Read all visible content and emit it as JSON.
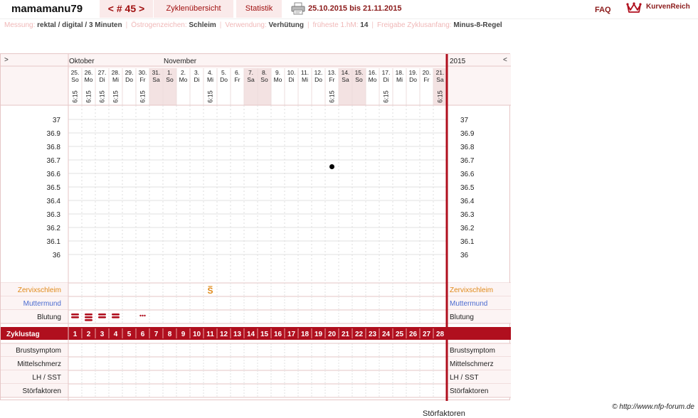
{
  "header": {
    "username": "mamamanu79",
    "cycle_prev": "<",
    "cycle_label": "# 45",
    "cycle_next": ">",
    "btn_overview": "Zyklenübersicht",
    "btn_stats": "Statistik",
    "date_range": "25.10.2015 bis 21.11.2015",
    "faq": "FAQ",
    "brand": "KurvenReich"
  },
  "settings": [
    {
      "key": "Messung:",
      "value": "rektal / digital / 3 Minuten"
    },
    {
      "key": "Östrogenzeichen:",
      "value": "Schleim"
    },
    {
      "key": "Verwendung:",
      "value": "Verhütung"
    },
    {
      "key": "früheste 1.hM:",
      "value": "14"
    },
    {
      "key": "Freigabe Zyklusanfang:",
      "value": "Minus-8-Regel"
    }
  ],
  "chart": {
    "nav_left": ">",
    "nav_right": "<",
    "months": [
      {
        "label": "Oktober",
        "day_index": 0
      },
      {
        "label": "November",
        "day_index": 7
      }
    ],
    "year": "2015",
    "days": [
      {
        "date": "25.",
        "wd": "So",
        "time": "6:15",
        "weekend": false
      },
      {
        "date": "26.",
        "wd": "Mo",
        "time": "6:15",
        "weekend": false
      },
      {
        "date": "27.",
        "wd": "Di",
        "time": "6:15",
        "weekend": false
      },
      {
        "date": "28.",
        "wd": "Mi",
        "time": "6:15",
        "weekend": false
      },
      {
        "date": "29.",
        "wd": "Do",
        "time": "",
        "weekend": false
      },
      {
        "date": "30.",
        "wd": "Fr",
        "time": "6:15",
        "weekend": false
      },
      {
        "date": "31.",
        "wd": "Sa",
        "time": "",
        "weekend": true
      },
      {
        "date": "1.",
        "wd": "So",
        "time": "",
        "weekend": true
      },
      {
        "date": "2.",
        "wd": "Mo",
        "time": "",
        "weekend": false
      },
      {
        "date": "3.",
        "wd": "Di",
        "time": "",
        "weekend": false
      },
      {
        "date": "4.",
        "wd": "Mi",
        "time": "6:15",
        "weekend": false
      },
      {
        "date": "5.",
        "wd": "Do",
        "time": "",
        "weekend": false
      },
      {
        "date": "6.",
        "wd": "Fr",
        "time": "",
        "weekend": false
      },
      {
        "date": "7.",
        "wd": "Sa",
        "time": "",
        "weekend": true
      },
      {
        "date": "8.",
        "wd": "So",
        "time": "",
        "weekend": true
      },
      {
        "date": "9.",
        "wd": "Mo",
        "time": "",
        "weekend": false
      },
      {
        "date": "10.",
        "wd": "Di",
        "time": "",
        "weekend": false
      },
      {
        "date": "11.",
        "wd": "Mi",
        "time": "",
        "weekend": false
      },
      {
        "date": "12.",
        "wd": "Do",
        "time": "",
        "weekend": false
      },
      {
        "date": "13.",
        "wd": "Fr",
        "time": "6:15",
        "weekend": false
      },
      {
        "date": "14.",
        "wd": "Sa",
        "time": "",
        "weekend": true
      },
      {
        "date": "15.",
        "wd": "So",
        "time": "",
        "weekend": true
      },
      {
        "date": "16.",
        "wd": "Mo",
        "time": "",
        "weekend": false
      },
      {
        "date": "17.",
        "wd": "Di",
        "time": "6:15",
        "weekend": false
      },
      {
        "date": "18.",
        "wd": "Mi",
        "time": "",
        "weekend": false
      },
      {
        "date": "19.",
        "wd": "Do",
        "time": "",
        "weekend": false
      },
      {
        "date": "20.",
        "wd": "Fr",
        "time": "",
        "weekend": false
      },
      {
        "date": "21.",
        "wd": "Sa",
        "time": "6:15",
        "weekend": true
      }
    ],
    "temp_ticks": [
      "37",
      "36.9",
      "36.8",
      "36.7",
      "36.6",
      "36.5",
      "36.4",
      "36.3",
      "36.2",
      "36.1",
      "36"
    ],
    "temp_range": [
      36.0,
      37.0
    ],
    "temperatures": [
      {
        "day_index": 19,
        "temp": 36.65
      }
    ],
    "rows_upper": [
      "Zervixschleim",
      "Muttermund",
      "Blutung"
    ],
    "mucus": [
      {
        "day_index": 10,
        "symbol": "S"
      }
    ],
    "bleeding": [
      {
        "day_index": 0,
        "level": "stark"
      },
      {
        "day_index": 1,
        "level": "sehr stark"
      },
      {
        "day_index": 2,
        "level": "stark"
      },
      {
        "day_index": 3,
        "level": "stark"
      },
      {
        "day_index": 5,
        "level": "Schmierblutung"
      }
    ],
    "cycle_day_label": "Zyklustag",
    "cycle_days": [
      "1",
      "2",
      "3",
      "4",
      "5",
      "6",
      "7",
      "8",
      "9",
      "10",
      "11",
      "12",
      "13",
      "14",
      "15",
      "16",
      "17",
      "18",
      "19",
      "20",
      "21",
      "22",
      "23",
      "24",
      "25",
      "26",
      "27",
      "28"
    ],
    "rows_lower": [
      "Brustsymptom",
      "Mittelschmerz",
      "LH / SST",
      "Störfaktoren"
    ]
  },
  "footer": {
    "copyright": "© http://www.nfp-forum.de",
    "stoer_bottom": "Störfaktoren"
  },
  "colors": {
    "accent": "#b00f1e",
    "zervix": "#e08a1a",
    "muttermund": "#4a6bd0",
    "weekend_bg": "#f3e2e2",
    "header_bg": "#fcf4f4"
  }
}
